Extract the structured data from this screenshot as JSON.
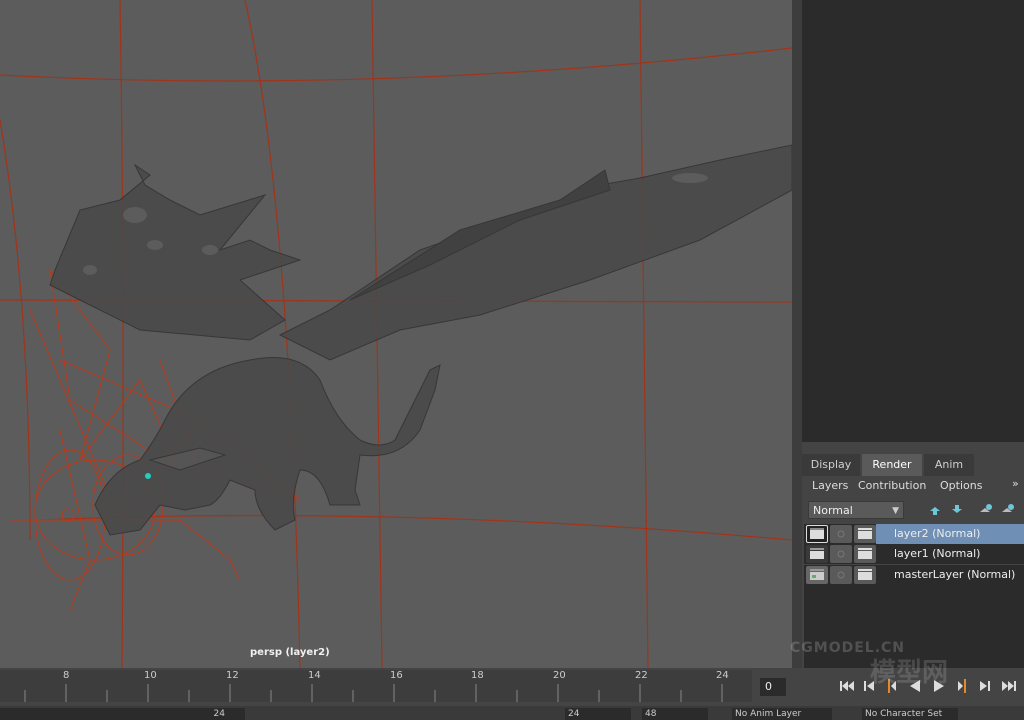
{
  "viewport": {
    "camera_label": "persp (layer2)",
    "grid_color": "#a0341a",
    "background_color": "#5c5c5c"
  },
  "layer_editor": {
    "tabs": [
      {
        "label": "Display",
        "active": false
      },
      {
        "label": "Render",
        "active": true
      },
      {
        "label": "Anim",
        "active": false
      }
    ],
    "menu": [
      "Layers",
      "Contribution",
      "Options"
    ],
    "blend_mode": "Normal",
    "layers": [
      {
        "name": "layer2 (Normal)",
        "selected": true
      },
      {
        "name": "layer1 (Normal)",
        "selected": false
      },
      {
        "name": "masterLayer (Normal)",
        "selected": false
      }
    ]
  },
  "timeline": {
    "ticks": [
      "8",
      "10",
      "12",
      "14",
      "16",
      "18",
      "20",
      "22",
      "24"
    ],
    "current_frame": "0",
    "playback_icons": [
      "go-to-start-icon",
      "step-back-key-icon",
      "step-back-frame-icon",
      "play-backwards-icon",
      "play-forwards-icon",
      "step-forward-frame-icon",
      "step-forward-key-icon",
      "go-to-end-icon"
    ]
  },
  "bottom_bar": {
    "start_frame": "24",
    "range_end": "24",
    "end_frame": "48",
    "anim_layer": "No Anim Layer",
    "character_set": "No Character Set"
  },
  "watermark": {
    "text": "CGMODEL.CN",
    "text2": "模型网"
  }
}
